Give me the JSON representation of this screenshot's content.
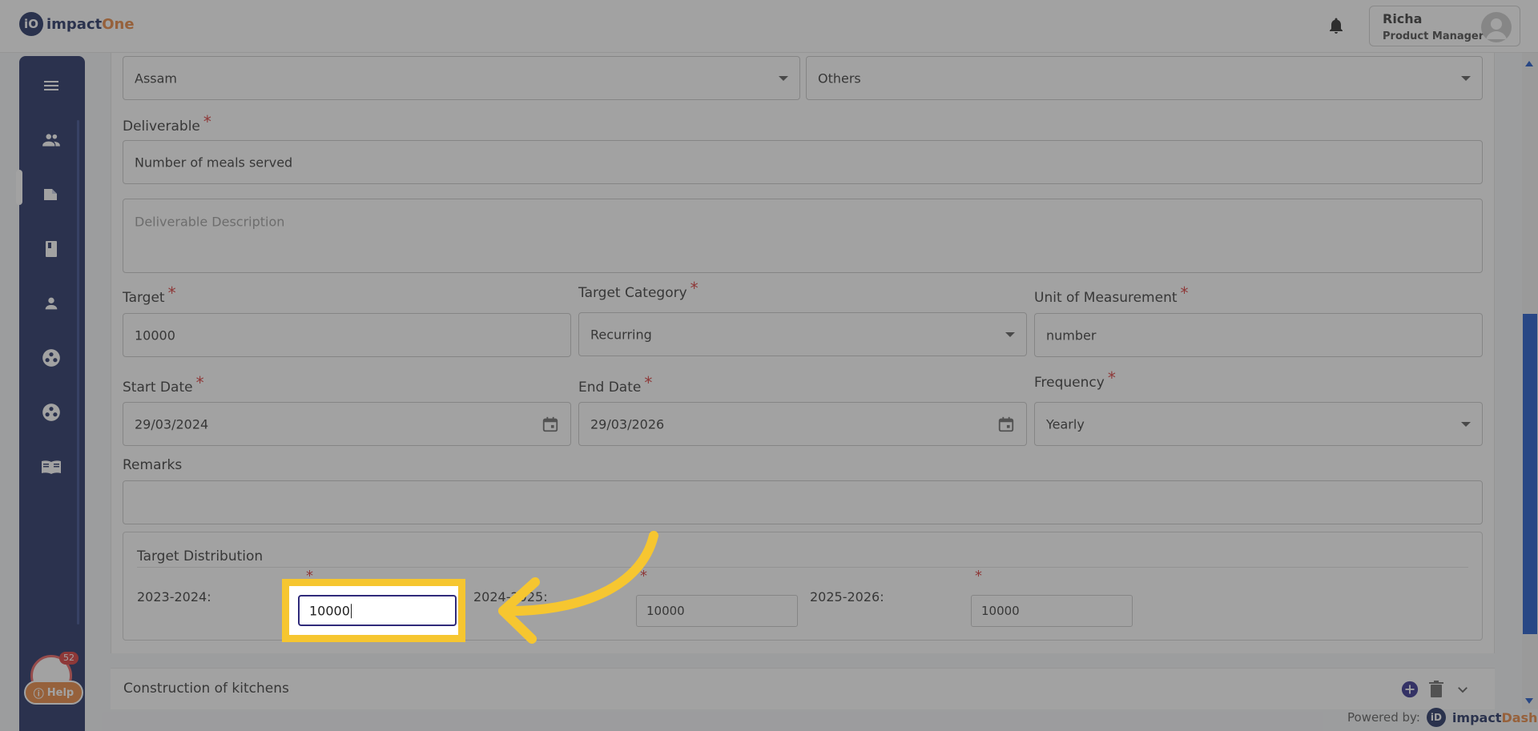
{
  "header": {
    "logo_badge": "iO",
    "logo_main": "impact",
    "logo_accent": "One",
    "user_name": "Richa",
    "user_role": "Product Manager"
  },
  "sidebar": {
    "items": [
      "menu-icon",
      "users-icon",
      "folder-icon",
      "book-icon",
      "person-icon",
      "group-icon",
      "network-icon",
      "manual-icon"
    ],
    "notification_count": "52",
    "help_label": "Help"
  },
  "form": {
    "state_value": "Assam",
    "category_value": "Others",
    "deliverable_label": "Deliverable",
    "deliverable_value": "Number of meals served",
    "description_placeholder": "Deliverable Description",
    "target_label": "Target",
    "target_value": "10000",
    "target_category_label": "Target Category",
    "target_category_value": "Recurring",
    "uom_label": "Unit of Measurement",
    "uom_value": "number",
    "start_date_label": "Start Date",
    "start_date_value": "29/03/2024",
    "end_date_label": "End Date",
    "end_date_value": "29/03/2026",
    "frequency_label": "Frequency",
    "frequency_value": "Yearly",
    "remarks_label": "Remarks",
    "remarks_value": "",
    "required_mark": "*"
  },
  "distribution": {
    "title": "Target Distribution",
    "periods": [
      {
        "label": "2023-2024:",
        "value": "10000"
      },
      {
        "label": "2024-2025:",
        "value": "10000"
      },
      {
        "label": "2025-2026:",
        "value": "10000"
      }
    ]
  },
  "next_section": {
    "title": "Construction of kitchens"
  },
  "footer": {
    "powered_by": "Powered by:",
    "brand_badge": "iD",
    "brand_main": "impact",
    "brand_accent": "Dash"
  },
  "colors": {
    "primary": "#1b2a5e",
    "accent": "#e8823a",
    "highlight": "#f6c630",
    "required": "#d93535"
  }
}
